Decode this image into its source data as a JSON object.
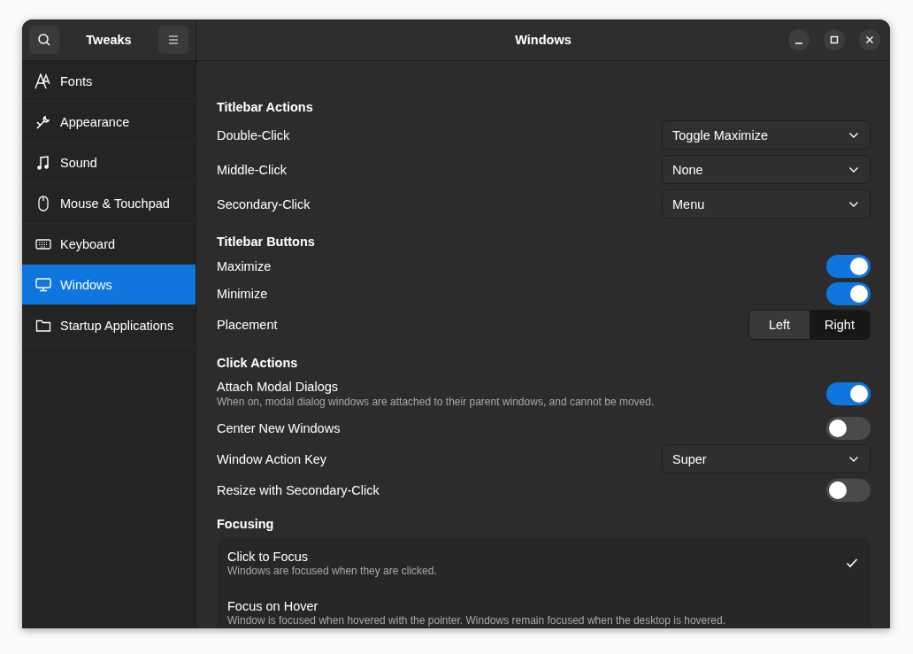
{
  "sidebar": {
    "title": "Tweaks",
    "items": [
      {
        "label": "Fonts",
        "selected": false
      },
      {
        "label": "Appearance",
        "selected": false
      },
      {
        "label": "Sound",
        "selected": false
      },
      {
        "label": "Mouse & Touchpad",
        "selected": false
      },
      {
        "label": "Keyboard",
        "selected": false
      },
      {
        "label": "Windows",
        "selected": true
      },
      {
        "label": "Startup Applications",
        "selected": false
      }
    ]
  },
  "window": {
    "title": "Windows"
  },
  "sections": [
    {
      "title": "Titlebar Actions",
      "rows": [
        {
          "kind": "dropdown",
          "label": "Double-Click",
          "value": "Toggle Maximize"
        },
        {
          "kind": "dropdown",
          "label": "Middle-Click",
          "value": "None"
        },
        {
          "kind": "dropdown",
          "label": "Secondary-Click",
          "value": "Menu"
        }
      ]
    },
    {
      "title": "Titlebar Buttons",
      "rows": [
        {
          "kind": "switch",
          "label": "Maximize",
          "on": true
        },
        {
          "kind": "switch",
          "label": "Minimize",
          "on": true
        },
        {
          "kind": "segmented",
          "label": "Placement",
          "options": [
            {
              "label": "Left",
              "selected": false
            },
            {
              "label": "Right",
              "selected": true
            }
          ]
        }
      ]
    },
    {
      "title": "Click Actions",
      "rows": [
        {
          "kind": "switch",
          "label": "Attach Modal Dialogs",
          "description": "When on, modal dialog windows are attached to their parent windows, and cannot be moved.",
          "on": true
        },
        {
          "kind": "switch",
          "label": "Center New Windows",
          "on": false
        },
        {
          "kind": "dropdown",
          "label": "Window Action Key",
          "value": "Super"
        },
        {
          "kind": "switch",
          "label": "Resize with Secondary-Click",
          "on": false
        }
      ]
    },
    {
      "title": "Focusing",
      "choices": [
        {
          "label": "Click to Focus",
          "description": "Windows are focused when they are clicked.",
          "selected": true
        },
        {
          "label": "Focus on Hover",
          "description": "Window is focused when hovered with the pointer. Windows remain focused when the desktop is hovered.",
          "selected": false
        }
      ]
    }
  ]
}
